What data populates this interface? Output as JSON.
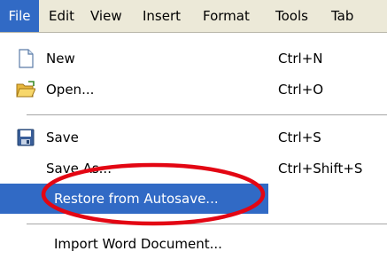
{
  "menubar": {
    "items": [
      "File",
      "Edit",
      "View",
      "Insert",
      "Format",
      "Tools",
      "Tab"
    ],
    "active_index": 0
  },
  "file_menu": {
    "items": [
      {
        "label": "New",
        "shortcut": "Ctrl+N",
        "icon": "new-document-icon"
      },
      {
        "label": "Open...",
        "shortcut": "Ctrl+O",
        "icon": "open-folder-icon"
      },
      {
        "label": "Save",
        "shortcut": "Ctrl+S",
        "icon": "save-disk-icon"
      },
      {
        "label": "Save As...",
        "shortcut": "Ctrl+Shift+S"
      },
      {
        "label": "Restore from Autosave...",
        "highlighted": true
      },
      {
        "label": "Import Word Document..."
      }
    ]
  },
  "colors": {
    "highlight": "#316ac5",
    "annotation": "#e30613",
    "menubar_bg": "#ece9d8"
  }
}
